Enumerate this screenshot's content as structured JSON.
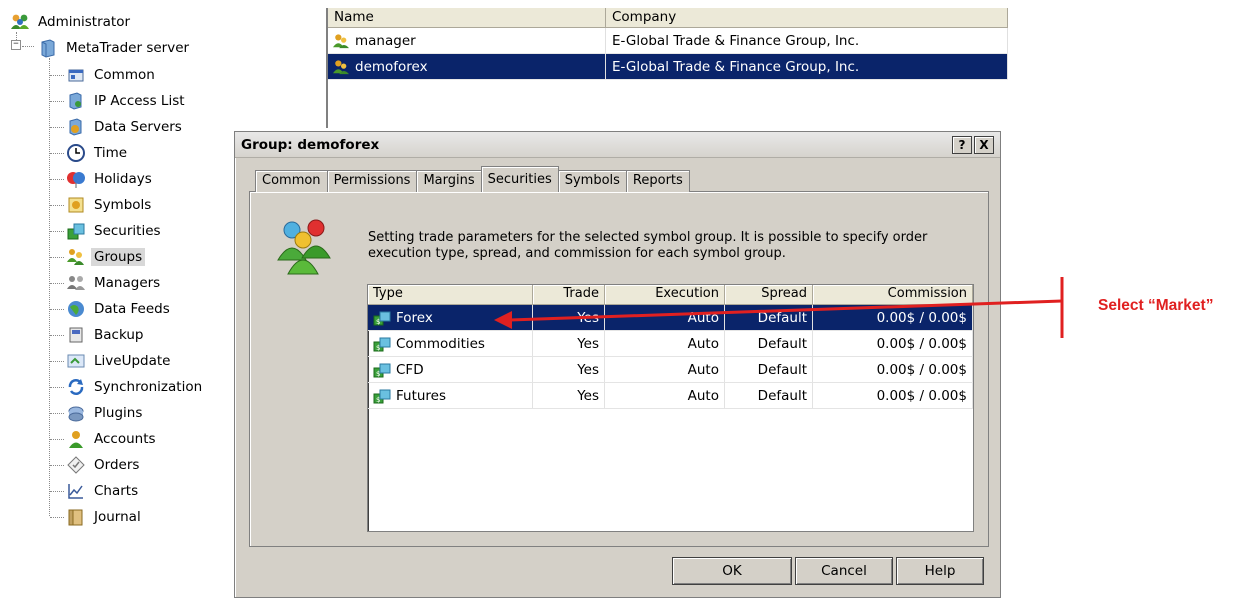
{
  "tree": {
    "root": "Administrator",
    "server": "MetaTrader server",
    "expander": "−",
    "items": [
      {
        "label": "Common",
        "icon": "common-icon"
      },
      {
        "label": "IP Access List",
        "icon": "ip-access-icon"
      },
      {
        "label": "Data Servers",
        "icon": "data-servers-icon"
      },
      {
        "label": "Time",
        "icon": "clock-icon"
      },
      {
        "label": "Holidays",
        "icon": "holidays-icon"
      },
      {
        "label": "Symbols",
        "icon": "symbols-icon"
      },
      {
        "label": "Securities",
        "icon": "securities-icon"
      },
      {
        "label": "Groups",
        "icon": "groups-icon",
        "selected": true
      },
      {
        "label": "Managers",
        "icon": "managers-icon"
      },
      {
        "label": "Data Feeds",
        "icon": "data-feeds-icon"
      },
      {
        "label": "Backup",
        "icon": "backup-icon"
      },
      {
        "label": "LiveUpdate",
        "icon": "liveupdate-icon"
      },
      {
        "label": "Synchronization",
        "icon": "sync-icon"
      },
      {
        "label": "Plugins",
        "icon": "plugins-icon"
      },
      {
        "label": "Accounts",
        "icon": "accounts-icon"
      },
      {
        "label": "Orders",
        "icon": "orders-icon"
      },
      {
        "label": "Charts",
        "icon": "charts-icon"
      },
      {
        "label": "Journal",
        "icon": "journal-icon"
      }
    ]
  },
  "group_list": {
    "columns": [
      "Name",
      "Company"
    ],
    "rows": [
      {
        "name": "manager",
        "company": "E-Global Trade & Finance Group, Inc.",
        "selected": false
      },
      {
        "name": "demoforex",
        "company": "E-Global Trade & Finance Group, Inc.",
        "selected": true
      }
    ]
  },
  "dialog": {
    "title": "Group: demoforex",
    "help_btn": "?",
    "close_btn": "X",
    "tabs": [
      "Common",
      "Permissions",
      "Margins",
      "Securities",
      "Symbols",
      "Reports"
    ],
    "active_tab": "Securities",
    "description": "Setting trade parameters for the selected symbol group. It is possible to specify order execution type, spread, and commission for each symbol group.",
    "grid": {
      "columns": [
        "Type",
        "Trade",
        "Execution",
        "Spread",
        "Commission"
      ],
      "rows": [
        {
          "type": "Forex",
          "trade": "Yes",
          "execution": "Auto",
          "spread": "Default",
          "commission": "0.00$ / 0.00$",
          "selected": true
        },
        {
          "type": "Commodities",
          "trade": "Yes",
          "execution": "Auto",
          "spread": "Default",
          "commission": "0.00$ / 0.00$",
          "selected": false
        },
        {
          "type": "CFD",
          "trade": "Yes",
          "execution": "Auto",
          "spread": "Default",
          "commission": "0.00$ / 0.00$",
          "selected": false
        },
        {
          "type": "Futures",
          "trade": "Yes",
          "execution": "Auto",
          "spread": "Default",
          "commission": "0.00$ / 0.00$",
          "selected": false
        }
      ]
    },
    "buttons": {
      "ok": "OK",
      "cancel": "Cancel",
      "help": "Help"
    }
  },
  "annotation": {
    "text": "Select “Market”",
    "color": "#e02020"
  },
  "colors": {
    "selection": "#0a246a",
    "dialog_bg": "#d4d0c8"
  }
}
